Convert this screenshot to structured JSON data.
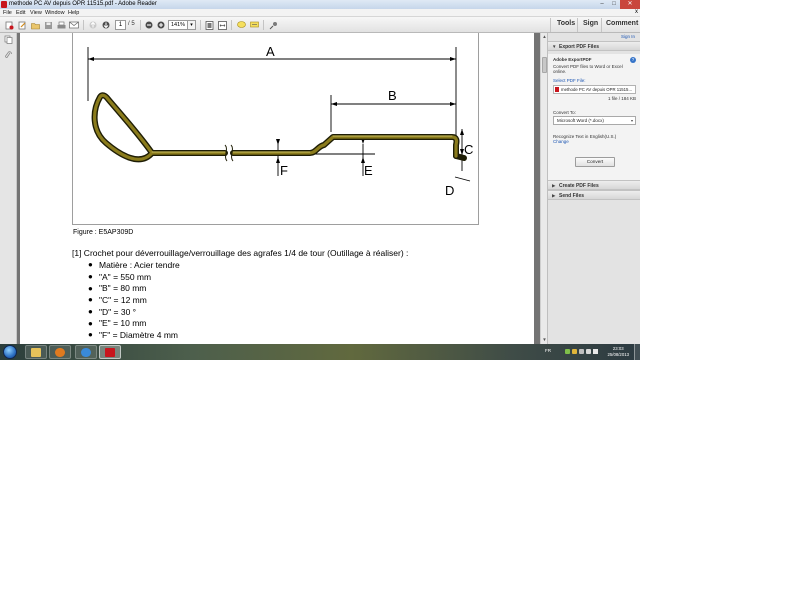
{
  "window": {
    "title": "methode PC AV depuis OPR 11515.pdf - Adobe Reader",
    "controls": {
      "minimize": "–",
      "maximize": "□",
      "close": "✕"
    }
  },
  "menubar": {
    "items": [
      "File",
      "Edit",
      "View",
      "Window",
      "Help"
    ],
    "close_doc": "x"
  },
  "toolbar": {
    "page_current": "1",
    "page_total": "/ 5",
    "zoom": "141%",
    "tabs": [
      "Tools",
      "Sign",
      "Comment"
    ]
  },
  "document": {
    "figure": {
      "labels": {
        "a": "A",
        "b": "B",
        "c": "C",
        "d": "D",
        "e": "E",
        "f": "F"
      },
      "caption": "Figure : E5AP309D"
    },
    "item_heading": "[1] Crochet pour déverrouillage/verrouillage des agrafes 1/4 de tour (Outillage à réaliser) :",
    "specs": [
      "Matière : Acier tendre",
      "\"A\" = 550 mm",
      "\"B\" = 80 mm",
      "\"C\" = 12 mm",
      "\"D\" = 30 °",
      "\"E\" = 10 mm",
      "\"F\" = Diamètre 4 mm"
    ],
    "bullet": "●"
  },
  "right_pane": {
    "sign_in": "Sign In",
    "export": {
      "header": "Export PDF Files",
      "product": "Adobe ExportPDF",
      "desc_line1": "Convert PDF files to Word or Excel",
      "desc_line2": "online.",
      "select_label": "Select PDF File:",
      "file_name": "methode PC AV depuis OPR 11515...",
      "file_count": "1 file / 184 KB",
      "convert_to_label": "Convert To:",
      "format": "Microsoft Word (*.docx)",
      "recognize": "Recognize Text in English(U.S.)",
      "change": "Change",
      "convert_button": "Convert"
    },
    "create": {
      "header": "Create PDF Files"
    },
    "send": {
      "header": "Send Files"
    }
  },
  "taskbar": {
    "language": "FR",
    "time": "23:03",
    "date": "25/08/2013"
  },
  "colors": {
    "accent_link": "#1c56b3",
    "adobe_red": "#c8161d",
    "wire_fill": "#8a7b1c",
    "doc_background": "#747474"
  }
}
